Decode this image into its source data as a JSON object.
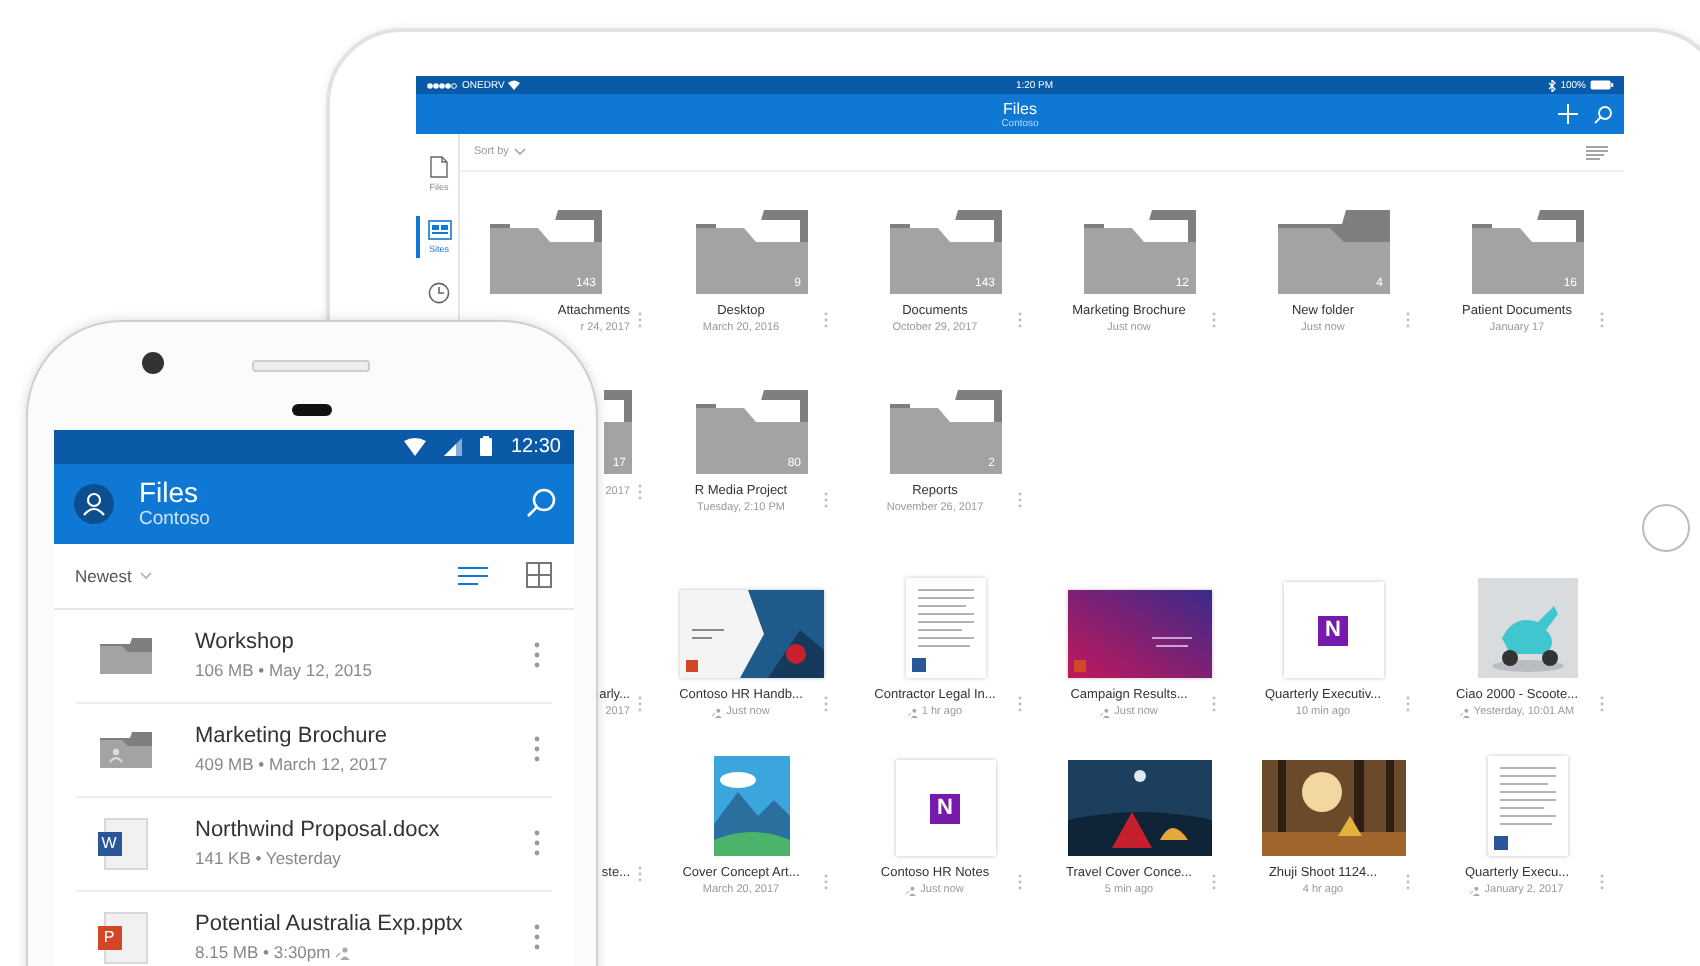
{
  "tablet": {
    "status_bar": {
      "carrier": "ONEDRV",
      "time": "1:20 PM",
      "battery": "100%"
    },
    "header": {
      "title": "Files",
      "subtitle": "Contoso"
    },
    "sidebar": [
      {
        "kind": "files",
        "label": "Files",
        "selected": false
      },
      {
        "kind": "sites",
        "label": "Sites",
        "selected": true
      },
      {
        "kind": "recent",
        "selected": false
      }
    ],
    "sort_label": "Sort by",
    "folders": [
      {
        "kind": "folder",
        "count": "143",
        "name": "Attachments",
        "meta": "r 24, 2017"
      },
      {
        "kind": "folder",
        "count": "9",
        "name": "Desktop",
        "meta": "March 20, 2016"
      },
      {
        "kind": "folder",
        "count": "143",
        "name": "Documents",
        "meta": "October 29, 2017"
      },
      {
        "kind": "folder",
        "count": "12",
        "name": "Marketing Brochure",
        "meta": "Just now"
      },
      {
        "kind": "empty-folder",
        "count": "4",
        "name": "New folder",
        "meta": "Just now"
      },
      {
        "kind": "folder",
        "count": "16",
        "name": "Patient Documents",
        "meta": "January 17"
      },
      {
        "kind": "folder",
        "count": "17",
        "meta": "2017"
      },
      {
        "kind": "folder",
        "count": "80",
        "name": "R Media Project",
        "meta": "Tuesday, 2:10 PM"
      },
      {
        "kind": "folder",
        "count": "2",
        "name": "Reports",
        "meta": "November 26, 2017"
      }
    ],
    "files": [
      {
        "name": "arly...",
        "meta": "2017",
        "shared": false
      },
      {
        "kind": "hr-slide",
        "name": "Contoso HR Handb...",
        "meta": "Just now",
        "shared": true
      },
      {
        "kind": "doc",
        "name": "Contractor Legal In...",
        "meta": "1 hr ago",
        "shared": true
      },
      {
        "kind": "campaign-slide",
        "name": "Campaign Results...",
        "meta": "Just now",
        "shared": true
      },
      {
        "kind": "onenote",
        "badge": "N",
        "name": "Quarterly Executiv...",
        "meta": "10 min ago",
        "shared": false
      },
      {
        "kind": "picture",
        "name": "Ciao 2000 - Scoote...",
        "meta": "Yesterday, 10:01 AM",
        "shared": true
      },
      {
        "name": "ste...",
        "shared": false
      },
      {
        "kind": "picture",
        "name": "Cover Concept Art...",
        "meta": "March 20, 2017",
        "shared": false
      },
      {
        "kind": "onenote",
        "badge": "N",
        "name": "Contoso HR Notes",
        "meta": "Just now",
        "shared": true
      },
      {
        "kind": "picture",
        "name": "Travel Cover Conce...",
        "meta": "5 min ago",
        "shared": false
      },
      {
        "kind": "picture",
        "name": "Zhuji Shoot 1124...",
        "meta": "4 hr ago",
        "shared": false
      },
      {
        "kind": "doc",
        "name": "Quarterly Execu...",
        "meta": "January 2, 2017",
        "shared": true
      }
    ]
  },
  "phone": {
    "status_bar": {
      "time": "12:30"
    },
    "header": {
      "title": "Files",
      "subtitle": "Contoso"
    },
    "sort_label": "Newest",
    "view_modes": [
      {
        "kind": "list",
        "selected": true
      },
      {
        "kind": "grid",
        "selected": false
      }
    ],
    "items": [
      {
        "kind": "folder",
        "name": "Workshop",
        "meta": "106 MB • May 12, 2015",
        "shared": false
      },
      {
        "kind": "shared-folder",
        "name": "Marketing Brochure",
        "meta": "409 MB • March 12, 2017",
        "shared": false
      },
      {
        "kind": "docx",
        "badge": "W",
        "name": "Northwind Proposal.docx",
        "meta": "141 KB • Yesterday",
        "shared": false
      },
      {
        "kind": "pptx",
        "badge": "P",
        "name": "Potential Australia Exp.pptx",
        "meta": "8.15 MB • 3:30pm",
        "shared": true
      }
    ]
  }
}
